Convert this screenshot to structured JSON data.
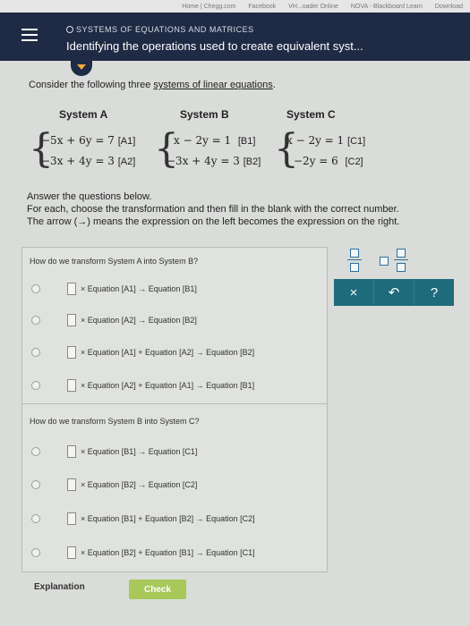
{
  "bookmarks": [
    "Home | Chegg.com",
    "Facebook",
    "VH...oader Online",
    "NOVA - Blackboard Learn",
    "Download"
  ],
  "header": {
    "topic": "SYSTEMS OF EQUATIONS AND MATRICES",
    "title": "Identifying the operations used to create equivalent syst..."
  },
  "intro": {
    "prefix": "Consider the following three ",
    "link": "systems of linear equations",
    "suffix": "."
  },
  "systems": {
    "a": {
      "label": "System A",
      "eq1": "−5x + 6y = 7",
      "tag1": "[A1]",
      "eq2": "−3x + 4y = 3",
      "tag2": "[A2]"
    },
    "b": {
      "label": "System B",
      "eq1": "x − 2y = 1",
      "tag1": "[B1]",
      "eq2": "−3x + 4y = 3",
      "tag2": "[B2]"
    },
    "c": {
      "label": "System C",
      "eq1": "x − 2y = 1",
      "tag1": "[C1]",
      "eq2": "−2y = 6",
      "tag2": "[C2]"
    }
  },
  "instructions": {
    "line1": "Answer the questions below.",
    "line2": "For each, choose the transformation and then fill in the blank with the correct number.",
    "line3_a": "The arrow (",
    "arrow": "→",
    "line3_b": ") means the expression on the left becomes the expression on the right."
  },
  "question1": {
    "prompt": "How do we transform System A into System B?",
    "options": [
      "× Equation [A1]  →  Equation [B1]",
      "× Equation [A2]  →  Equation [B2]",
      "× Equation [A1] + Equation [A2]  →  Equation [B2]",
      "× Equation [A2] + Equation [A1]  →  Equation [B1]"
    ]
  },
  "question2": {
    "prompt": "How do we transform System B into System C?",
    "options": [
      "× Equation [B1]  →  Equation [C1]",
      "× Equation [B2]  →  Equation [C2]",
      "× Equation [B1] + Equation [B2]  →  Equation [C2]",
      "× Equation [B2] + Equation [B1]  →  Equation [C1]"
    ]
  },
  "keypad": {
    "clear": "×",
    "undo": "↶",
    "help": "?"
  },
  "footer": {
    "explanation": "Explanation",
    "check": "Check"
  },
  "colors": {
    "header_bg": "#1f2a44",
    "key_bg": "#1e6b7c",
    "check_bg": "#a8c85a",
    "accent": "#f2a93b"
  }
}
